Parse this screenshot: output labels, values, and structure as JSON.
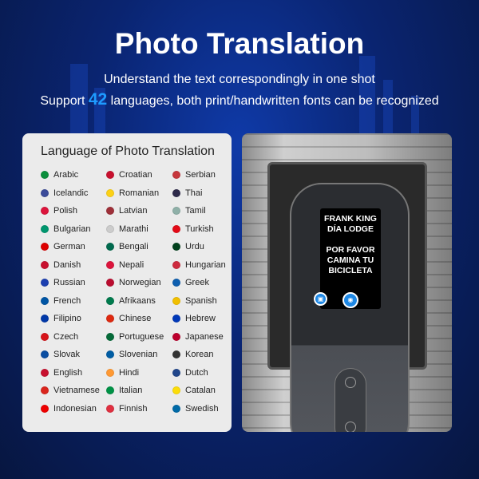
{
  "header": {
    "title": "Photo Translation",
    "line1": "Understand the text correspondingly in one shot",
    "line2_pre": "Support ",
    "line2_count": "42",
    "line2_post": " languages, both print/handwritten fonts can be recognized"
  },
  "card": {
    "title": "Language of Photo Translation",
    "columns": [
      [
        {
          "name": "Arabic",
          "color": "#0a8f3c"
        },
        {
          "name": "Icelandic",
          "color": "#3b4b9a"
        },
        {
          "name": "Polish",
          "color": "#dc143c"
        },
        {
          "name": "Bulgarian",
          "color": "#00966e"
        },
        {
          "name": "German",
          "color": "#d00"
        },
        {
          "name": "Danish",
          "color": "#c8102e"
        },
        {
          "name": "Russian",
          "color": "#1c3fb0"
        },
        {
          "name": "French",
          "color": "#0055a4"
        },
        {
          "name": "Filipino",
          "color": "#0038a8"
        },
        {
          "name": "Czech",
          "color": "#d7141a"
        },
        {
          "name": "Slovak",
          "color": "#0b4ea2"
        },
        {
          "name": "English",
          "color": "#c8102e"
        },
        {
          "name": "Vietnamese",
          "color": "#da251d"
        },
        {
          "name": "Indonesian",
          "color": "#e00"
        }
      ],
      [
        {
          "name": "Croatian",
          "color": "#c8102e"
        },
        {
          "name": "Romanian",
          "color": "#fcd116"
        },
        {
          "name": "Latvian",
          "color": "#9e3039"
        },
        {
          "name": "Marathi",
          "color": "#cccccc"
        },
        {
          "name": "Bengali",
          "color": "#006a4e"
        },
        {
          "name": "Nepali",
          "color": "#dc143c"
        },
        {
          "name": "Norwegian",
          "color": "#ba0c2f"
        },
        {
          "name": "Afrikaans",
          "color": "#007a4d"
        },
        {
          "name": "Chinese",
          "color": "#de2910"
        },
        {
          "name": "Portuguese",
          "color": "#046a38"
        },
        {
          "name": "Slovenian",
          "color": "#005da4"
        },
        {
          "name": "Hindi",
          "color": "#ff9933"
        },
        {
          "name": "Italian",
          "color": "#009246"
        },
        {
          "name": "Finnish",
          "color": "#e03040"
        }
      ],
      [
        {
          "name": "Serbian",
          "color": "#c6363c"
        },
        {
          "name": "Thai",
          "color": "#2d2a4a"
        },
        {
          "name": "Tamil",
          "color": "#8fb0a8"
        },
        {
          "name": "Turkish",
          "color": "#e30a17"
        },
        {
          "name": "Urdu",
          "color": "#01411c"
        },
        {
          "name": "Hungarian",
          "color": "#cd2a3e"
        },
        {
          "name": "Greek",
          "color": "#0d5eaf"
        },
        {
          "name": "Spanish",
          "color": "#f1bf00"
        },
        {
          "name": "Hebrew",
          "color": "#0038b8"
        },
        {
          "name": "Japanese",
          "color": "#bc002d"
        },
        {
          "name": "Korean",
          "color": "#333"
        },
        {
          "name": "Dutch",
          "color": "#21468b"
        },
        {
          "name": "Catalan",
          "color": "#fcdd09"
        },
        {
          "name": "Swedish",
          "color": "#006aa7"
        }
      ]
    ]
  },
  "device": {
    "screen_lines": [
      "FRANK KING",
      "DÍA LODGE",
      "",
      "POR FAVOR",
      "CAMINA TU",
      "BICICLETA"
    ],
    "gallery_icon": "image-icon",
    "camera_icon": "camera-icon",
    "accent": "#1e88e5"
  }
}
